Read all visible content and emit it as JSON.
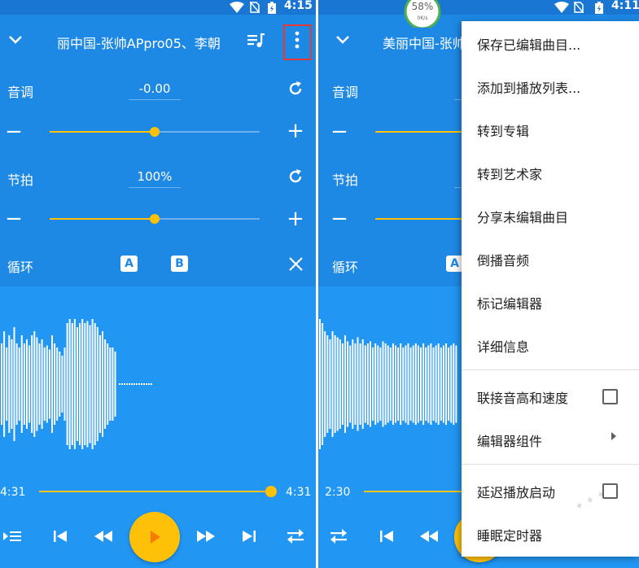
{
  "left": {
    "status_time": "4:15",
    "title": "丽中国-张帅APpro05、李朝",
    "pitch_label": "音调",
    "pitch_value": "-0.00",
    "tempo_label": "节拍",
    "tempo_value": "100%",
    "loop_label": "循环",
    "marker_a": "A",
    "marker_b": "B",
    "time_start": "4:31",
    "time_end": "4:31",
    "pitch_slider_level": 0.5,
    "tempo_slider_level": 0.5,
    "seek_progress": 1.0
  },
  "right": {
    "status_time": "4:11",
    "title": "美丽中国-张帅",
    "pitch_label": "音调",
    "tempo_label": "节拍",
    "loop_label": "循环",
    "marker_a": "A",
    "time_start": "2:30",
    "battery_percent": "58%",
    "battery_rate": "0K/s"
  },
  "menu": {
    "items": [
      {
        "label": "保存已编辑曲目..."
      },
      {
        "label": "添加到播放列表..."
      },
      {
        "label": "转到专辑"
      },
      {
        "label": "转到艺术家"
      },
      {
        "label": "分享未编辑曲目"
      },
      {
        "label": "倒播音频"
      },
      {
        "label": "标记编辑器"
      },
      {
        "label": "详细信息"
      },
      {
        "label": "联接音高和速度",
        "checkbox": false
      },
      {
        "label": "编辑器组件",
        "submenu": true
      },
      {
        "label": "延迟播放启动",
        "checkbox": false
      },
      {
        "label": "睡眠定时器"
      }
    ]
  },
  "colors": {
    "primary": "#2196f3",
    "primary_dark": "#1976d2",
    "accent": "#ffc107",
    "highlight_box": "#e53935"
  },
  "icons": [
    "chevron-down-icon",
    "queue-music-icon",
    "more-vert-icon",
    "reset-icon",
    "minus-icon",
    "plus-icon",
    "close-icon",
    "queue-icon",
    "skip-previous-icon",
    "rewind-icon",
    "play-icon",
    "fast-forward-icon",
    "skip-next-icon",
    "repeat-icon",
    "wifi-icon",
    "no-sim-icon",
    "battery-icon"
  ]
}
